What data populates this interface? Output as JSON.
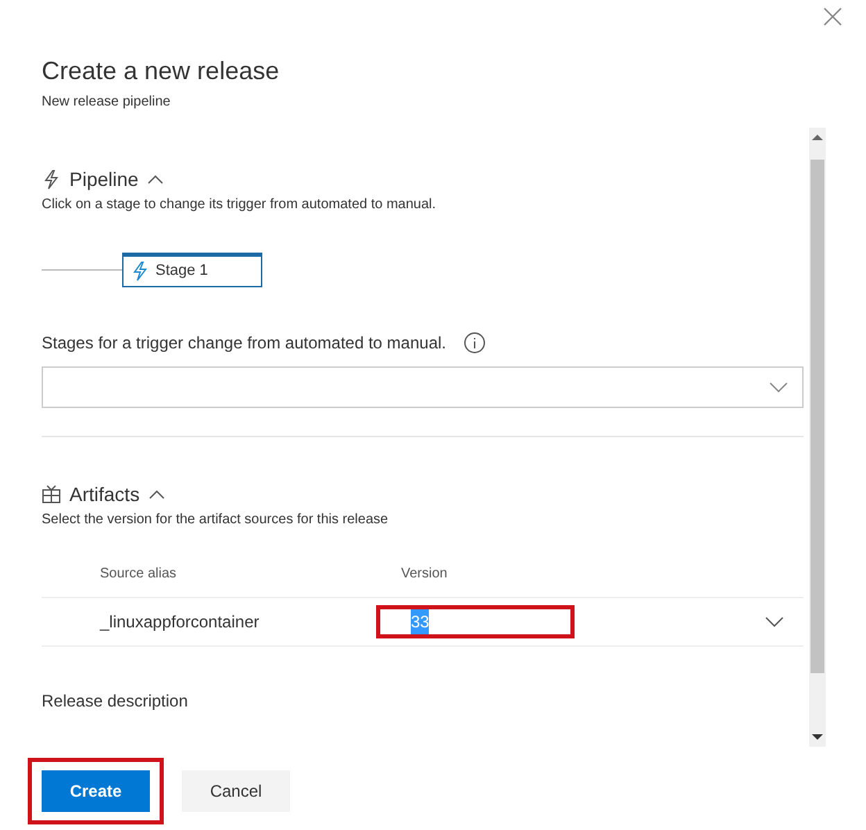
{
  "dialog": {
    "title": "Create a new release",
    "subtitle": "New release pipeline"
  },
  "pipeline": {
    "heading": "Pipeline",
    "expanded": true,
    "hint": "Click on a stage to change its trigger from automated to manual.",
    "stages": [
      {
        "name": "Stage 1",
        "selected": true
      }
    ]
  },
  "trigger_field": {
    "label": "Stages for a trigger change from automated to manual."
  },
  "artifacts": {
    "heading": "Artifacts",
    "expanded": true,
    "hint": "Select the version for the artifact sources for this release",
    "columns": [
      "Source alias",
      "Version"
    ],
    "rows": [
      {
        "source_alias": "_linuxappforcontainer",
        "version": "33",
        "highlighted": true
      }
    ]
  },
  "release_description": {
    "label": "Release description"
  },
  "buttons": [
    {
      "label": "Create",
      "kind": "primary",
      "highlighted": true
    },
    {
      "label": "Cancel",
      "kind": "secondary",
      "highlighted": false
    }
  ]
}
